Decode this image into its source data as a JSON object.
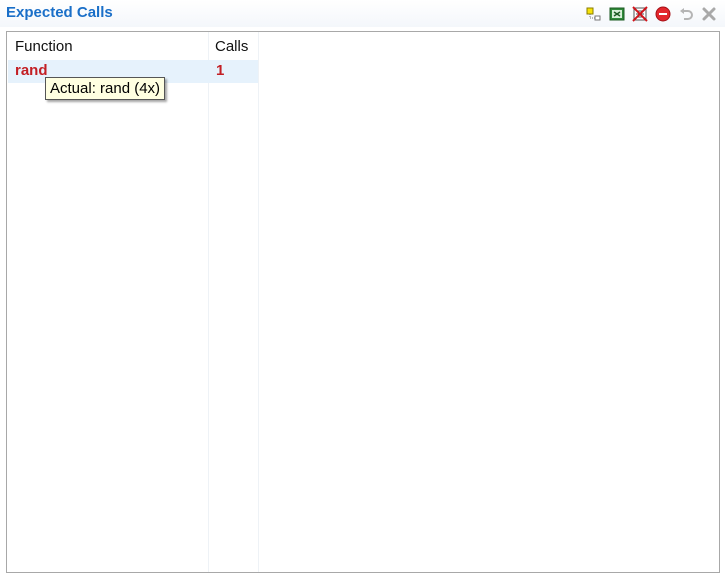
{
  "window": {
    "title": "Expected Calls"
  },
  "toolbar": {
    "icons": [
      "tree-expand-icon",
      "export-icon",
      "clear-all-icon",
      "stop-icon",
      "undo-icon",
      "close-icon"
    ]
  },
  "table": {
    "columns": [
      "Function",
      "Calls"
    ],
    "rows": [
      {
        "function": "rand",
        "calls": "1"
      }
    ]
  },
  "tooltip": {
    "text": "Actual: rand (4x)"
  },
  "colors": {
    "title": "#1a6fc8",
    "error_text": "#c31f24",
    "row_highlight": "#e6f2fc",
    "tooltip_bg": "#ffffe1"
  }
}
